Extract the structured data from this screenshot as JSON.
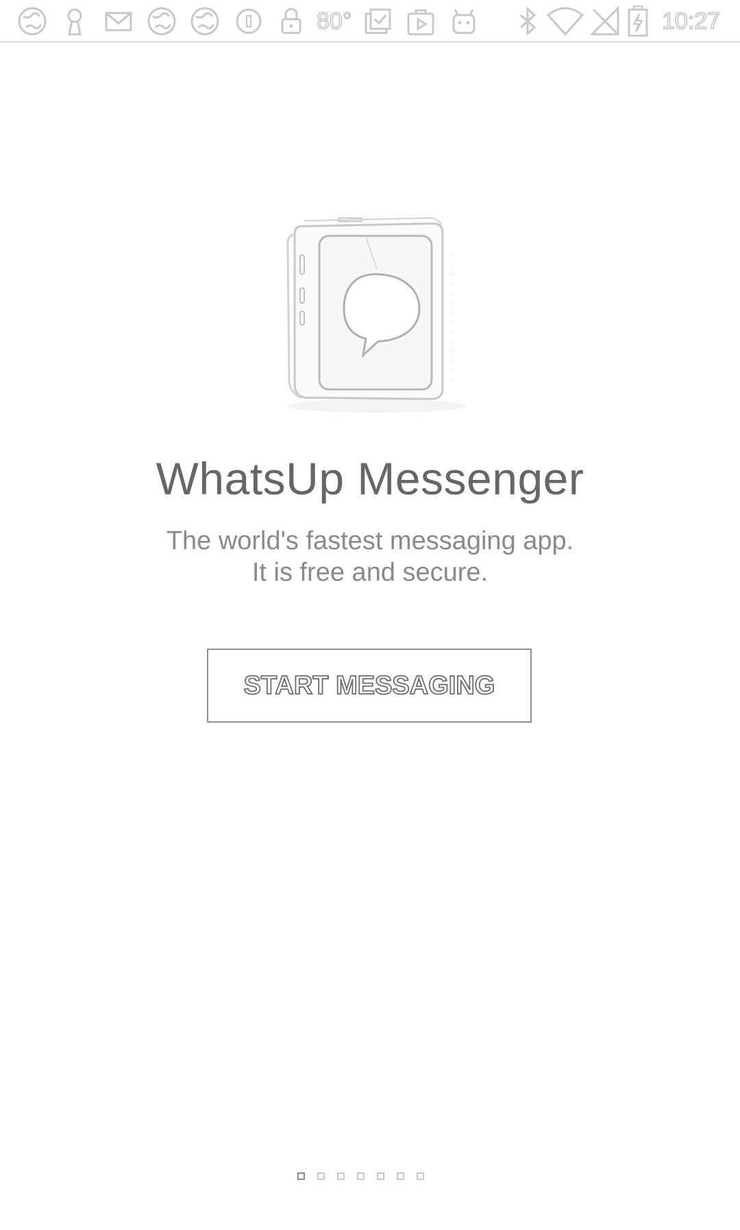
{
  "status_bar": {
    "temperature": "80°",
    "time": "10:27",
    "icons": [
      "globe-icon",
      "keyhole-icon",
      "mail-icon",
      "globe-icon",
      "globe-icon",
      "circle-icon",
      "lock-icon",
      "clipboard-check-icon",
      "play-store-icon",
      "android-icon",
      "bluetooth-icon",
      "wifi-icon",
      "no-signal-icon",
      "battery-charging-icon"
    ]
  },
  "hero": {
    "icon": "message-device-illustration"
  },
  "title": "WhatsUp Messenger",
  "tagline_line1": "The world's fastest messaging app.",
  "tagline_line2": "It is free and secure.",
  "start_button_label": "START MESSAGING",
  "pager": {
    "count": 7,
    "active_index": 0
  }
}
